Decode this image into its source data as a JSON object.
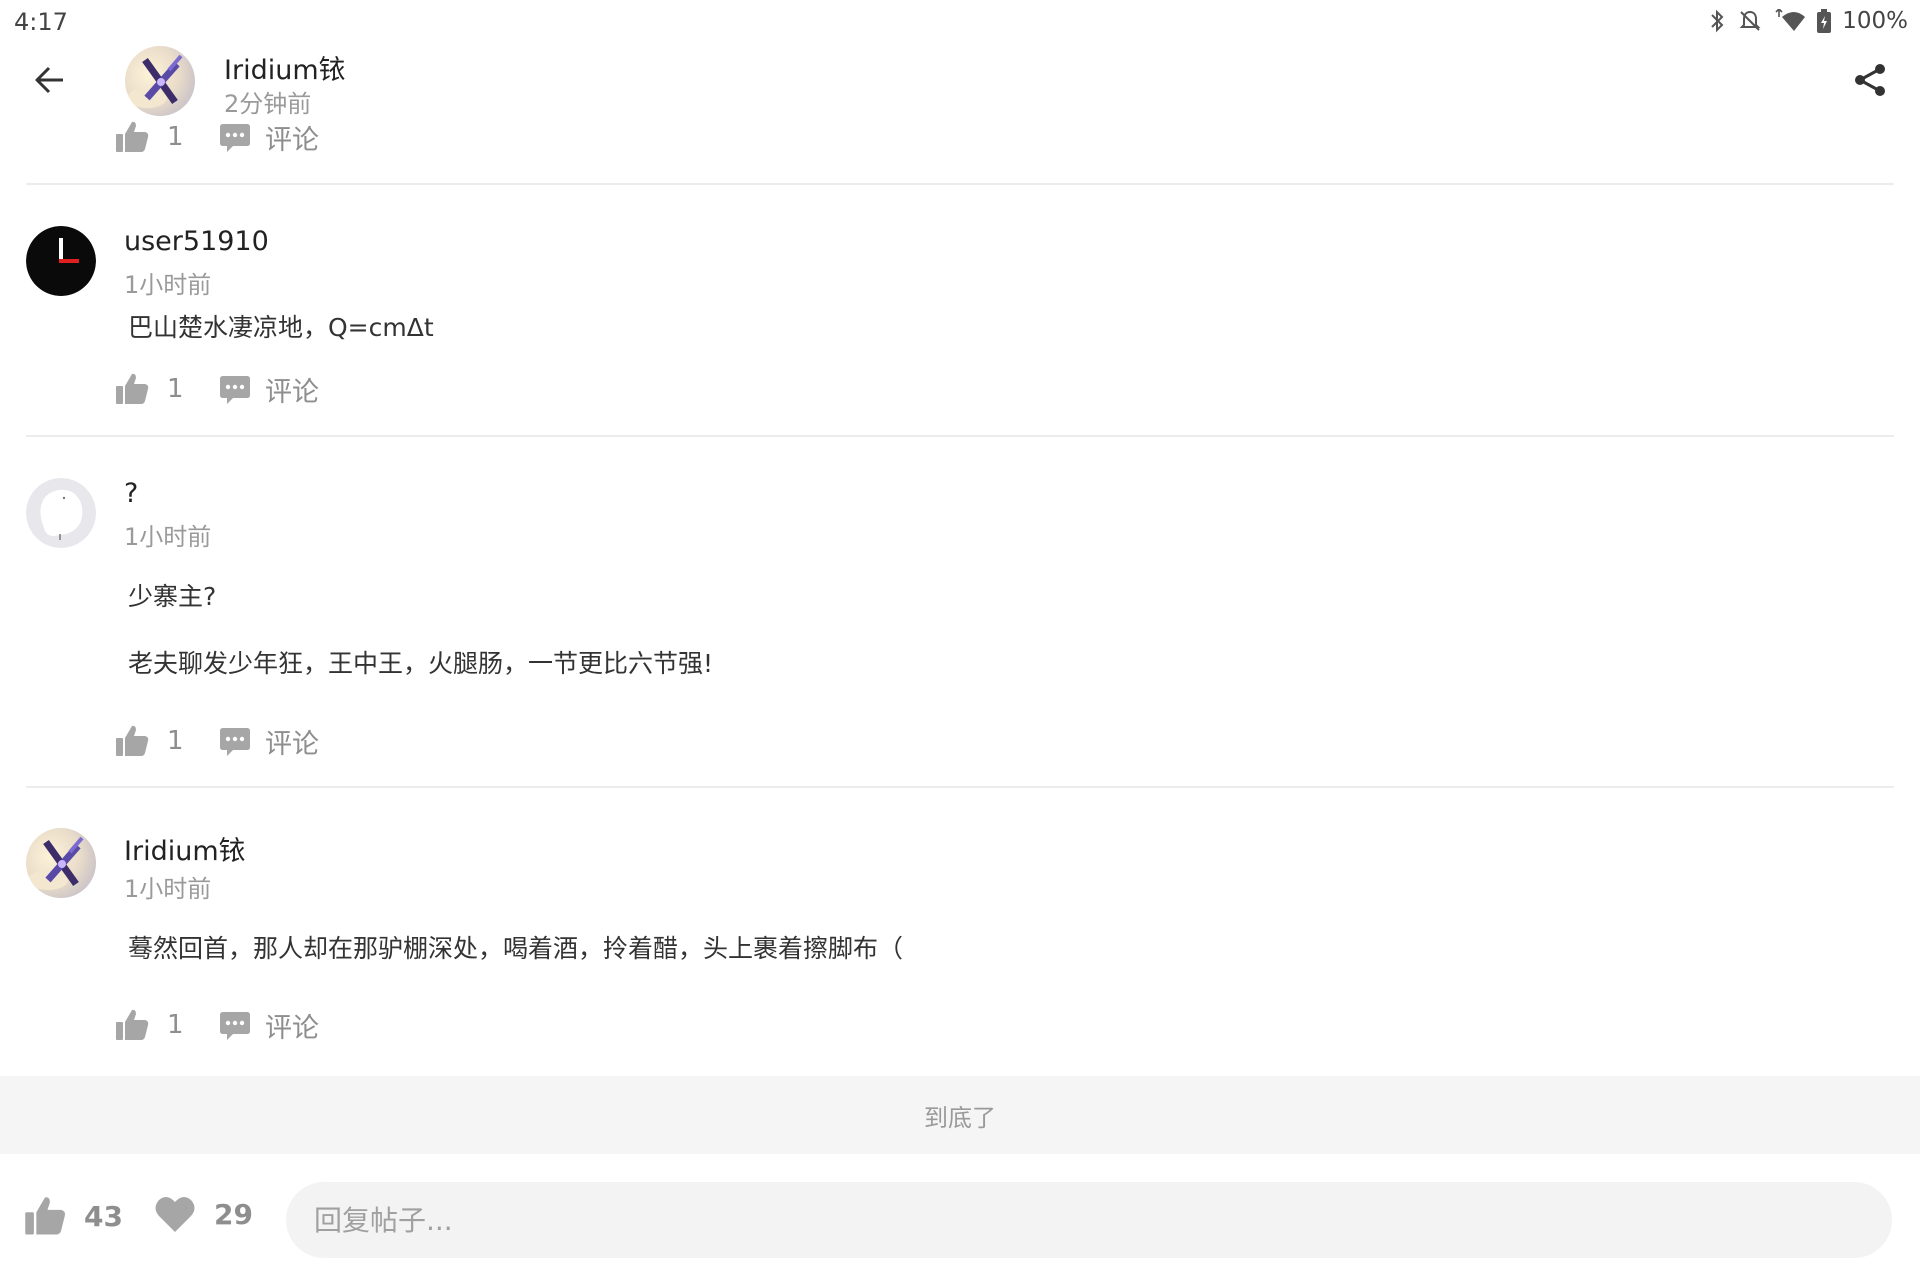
{
  "status_bar": {
    "time": "4:17",
    "battery": "100%"
  },
  "header": {
    "author_name": "Iridium铱",
    "time_ago": "2分钟前",
    "like_count": "1",
    "comment_label": "评论"
  },
  "comments": [
    {
      "user": "user51910",
      "time": "1小时前",
      "lines": [
        "巴山楚水凄凉地，Q=cmΔt"
      ],
      "like_count": "1",
      "comment_label": "评论"
    },
    {
      "user": "?",
      "time": "1小时前",
      "lines": [
        "少寨主?",
        "老夫聊发少年狂，王中王，火腿肠，一节更比六节强!"
      ],
      "like_count": "1",
      "comment_label": "评论"
    },
    {
      "user": "Iridium铱",
      "time": "1小时前",
      "lines": [
        "蓦然回首，那人却在那驴棚深处，喝着酒，拎着醋，头上裹着擦脚布（"
      ],
      "like_count": "1",
      "comment_label": "评论"
    }
  ],
  "end_of_list": "到底了",
  "bottom_bar": {
    "like_count": "43",
    "favorite_count": "29",
    "reply_placeholder": "回复帖子..."
  },
  "colors": {
    "icon_gray": "#a6a6a6",
    "text_gray": "#9a9a9a",
    "divider": "#ececec",
    "end_bar_bg": "#f4f5f4"
  }
}
